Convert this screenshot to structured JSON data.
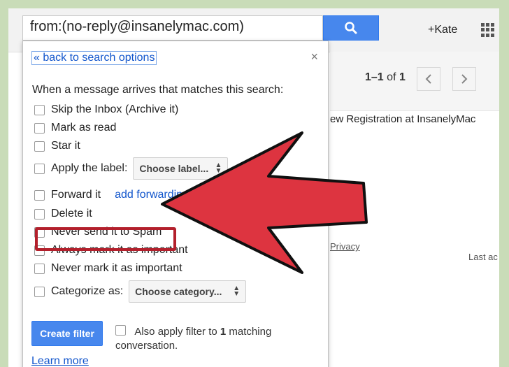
{
  "search": {
    "query": "from:(no-reply@insanelymac.com)",
    "button_icon": "search-icon"
  },
  "header": {
    "user": "+Kate",
    "apps_icon": "apps-grid-icon"
  },
  "mail": {
    "pager_range": "1–1",
    "pager_of": "of",
    "pager_total": "1",
    "prev_icon": "chevron-left-icon",
    "next_icon": "chevron-right-icon",
    "subject": "ew Registration at InsanelyMac",
    "privacy": "Privacy",
    "last_activity": "Last ac"
  },
  "dialog": {
    "back_link": "« back to search options",
    "close_icon": "×",
    "intro": "When a message arrives that matches this search:",
    "options": {
      "skip_inbox": "Skip the Inbox (Archive it)",
      "mark_read": "Mark as read",
      "star": "Star it",
      "apply_label": "Apply the label:",
      "label_select": "Choose label...",
      "forward": "Forward it",
      "forward_link": "add forwarding",
      "delete": "Delete it",
      "never_spam": "Never send it to Spam",
      "always_important": "Always mark it as important",
      "never_important": "Never mark it as important",
      "categorize": "Categorize as:",
      "category_select": "Choose category..."
    },
    "create_button": "Create filter",
    "also_prefix": "Also apply filter to",
    "also_count": "1",
    "also_suffix": "matching",
    "also_line2": "conversation.",
    "learn_more": "Learn more"
  },
  "annotation": {
    "highlight_color": "#b3202c",
    "arrow_color": "#dd3440"
  }
}
